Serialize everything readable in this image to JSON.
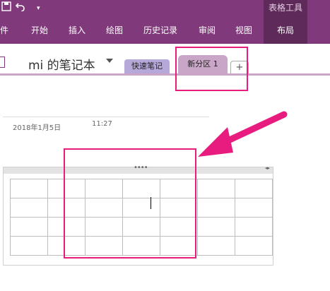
{
  "ribbon": {
    "quick_access": {
      "save_icon": "save-icon",
      "undo_icon": "undo-icon",
      "customize_icon": "customize-icon"
    },
    "menu": [
      "件",
      "开始",
      "插入",
      "绘图",
      "历史记录",
      "审阅",
      "视图"
    ],
    "table_tools": {
      "title": "表格工具",
      "layout_tab": "布局"
    },
    "colors": {
      "ribbon_bg": "#80397B",
      "table_tools_bg": "#5d2a5a"
    }
  },
  "notebook": {
    "title": "mi 的笔记本",
    "sections": [
      {
        "label": "快速笔记"
      },
      {
        "label": "新分区 1",
        "active": true
      }
    ],
    "add_section": "+"
  },
  "page": {
    "date": "2018年1月5日",
    "time": "11:27"
  },
  "table": {
    "rows": 4,
    "cols": 7,
    "grip": "••••",
    "resize_arrows": "◂▸"
  },
  "annotations": {
    "highlight_color": "#e81b7f"
  }
}
